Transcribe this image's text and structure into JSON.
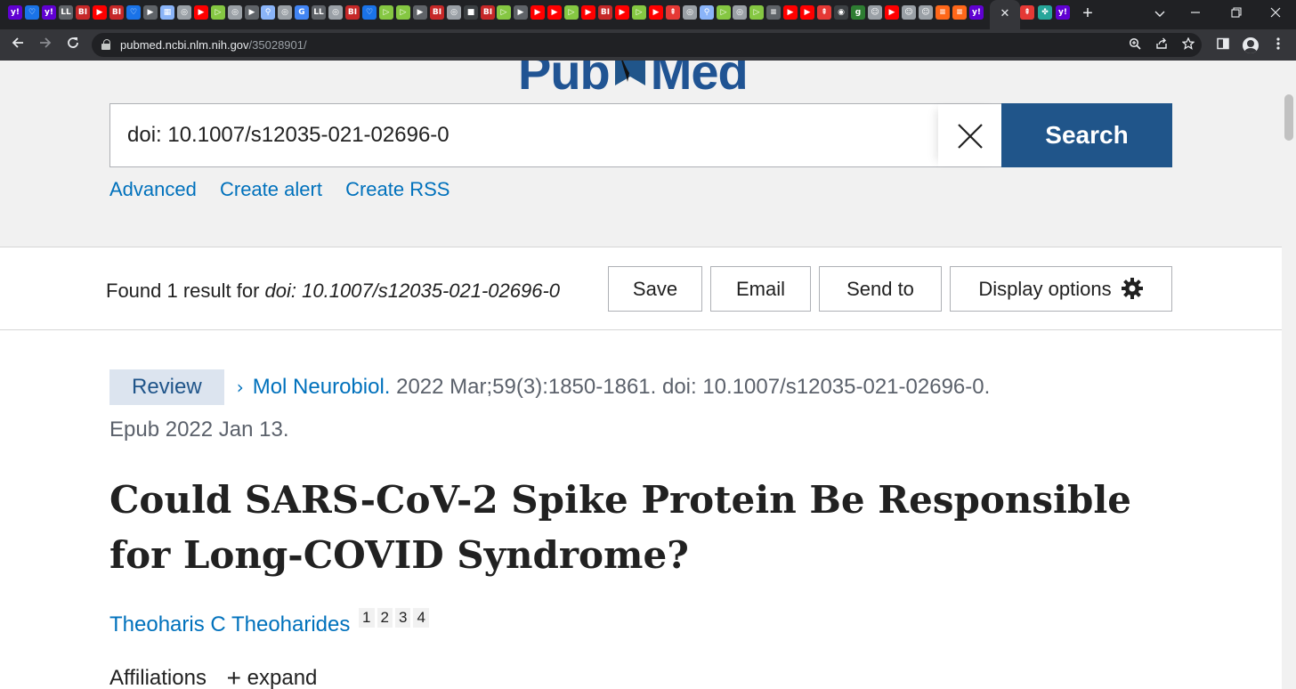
{
  "browser": {
    "tabs": [
      {
        "icon": "yahoo-icon",
        "glyph": "y!",
        "color": "#6001d2"
      },
      {
        "icon": "shield-icon",
        "glyph": "♡",
        "color": "#1a73e8"
      },
      {
        "icon": "yahoo-icon",
        "glyph": "y!",
        "color": "#6001d2"
      },
      {
        "icon": "lifesite-icon",
        "glyph": "LL",
        "color": "#5f6368"
      },
      {
        "icon": "business-insider-icon",
        "glyph": "BI",
        "color": "#c62828"
      },
      {
        "icon": "youtube-icon",
        "glyph": "▶",
        "color": "#ff0000"
      },
      {
        "icon": "business-insider-icon",
        "glyph": "BI",
        "color": "#c62828"
      },
      {
        "icon": "shield-icon",
        "glyph": "♡",
        "color": "#1a73e8"
      },
      {
        "icon": "play-icon",
        "glyph": "▶",
        "color": "#5f6368"
      },
      {
        "icon": "doc-icon",
        "glyph": "▦",
        "color": "#8ab4f8"
      },
      {
        "icon": "globe-icon",
        "glyph": "◎",
        "color": "#9aa0a6"
      },
      {
        "icon": "youtube-icon",
        "glyph": "▶",
        "color": "#ff0000"
      },
      {
        "icon": "rumble-icon",
        "glyph": "▷",
        "color": "#85c742"
      },
      {
        "icon": "globe-icon",
        "glyph": "◎",
        "color": "#9aa0a6"
      },
      {
        "icon": "play-icon",
        "glyph": "▶",
        "color": "#5f6368"
      },
      {
        "icon": "search-icon",
        "glyph": "⚲",
        "color": "#8ab4f8"
      },
      {
        "icon": "globe-icon",
        "glyph": "◎",
        "color": "#9aa0a6"
      },
      {
        "icon": "google-icon",
        "glyph": "G",
        "color": "#4285f4"
      },
      {
        "icon": "lifesite-icon",
        "glyph": "LL",
        "color": "#5f6368"
      },
      {
        "icon": "globe-icon",
        "glyph": "◎",
        "color": "#9aa0a6"
      },
      {
        "icon": "business-insider-icon",
        "glyph": "BI",
        "color": "#c62828"
      },
      {
        "icon": "shield-icon",
        "glyph": "♡",
        "color": "#1a73e8"
      },
      {
        "icon": "rumble-icon",
        "glyph": "▷",
        "color": "#85c742"
      },
      {
        "icon": "rumble-icon",
        "glyph": "▷",
        "color": "#85c742"
      },
      {
        "icon": "play-icon",
        "glyph": "▶",
        "color": "#5f6368"
      },
      {
        "icon": "business-insider-icon",
        "glyph": "BI",
        "color": "#c62828"
      },
      {
        "icon": "globe-icon",
        "glyph": "◎",
        "color": "#9aa0a6"
      },
      {
        "icon": "dark-icon",
        "glyph": "■",
        "color": "#3c4043"
      },
      {
        "icon": "business-insider-icon",
        "glyph": "BI",
        "color": "#c62828"
      },
      {
        "icon": "rumble-icon",
        "glyph": "▷",
        "color": "#85c742"
      },
      {
        "icon": "play-icon",
        "glyph": "▶",
        "color": "#5f6368"
      },
      {
        "icon": "youtube-icon",
        "glyph": "▶",
        "color": "#ff0000"
      },
      {
        "icon": "youtube-icon",
        "glyph": "▶",
        "color": "#ff0000"
      },
      {
        "icon": "rumble-icon",
        "glyph": "▷",
        "color": "#85c742"
      },
      {
        "icon": "youtube-icon",
        "glyph": "▶",
        "color": "#ff0000"
      },
      {
        "icon": "business-insider-icon",
        "glyph": "BI",
        "color": "#c62828"
      },
      {
        "icon": "youtube-icon",
        "glyph": "▶",
        "color": "#ff0000"
      },
      {
        "icon": "rumble-icon",
        "glyph": "▷",
        "color": "#85c742"
      },
      {
        "icon": "youtube-icon",
        "glyph": "▶",
        "color": "#ff0000"
      },
      {
        "icon": "gettr-icon",
        "glyph": "⇞",
        "color": "#e53935"
      },
      {
        "icon": "globe-icon",
        "glyph": "◎",
        "color": "#9aa0a6"
      },
      {
        "icon": "search-icon",
        "glyph": "⚲",
        "color": "#8ab4f8"
      },
      {
        "icon": "rumble-icon",
        "glyph": "▷",
        "color": "#85c742"
      },
      {
        "icon": "globe-icon",
        "glyph": "◎",
        "color": "#9aa0a6"
      },
      {
        "icon": "rumble-icon",
        "glyph": "▷",
        "color": "#85c742"
      },
      {
        "icon": "news-icon",
        "glyph": "≡",
        "color": "#5f6368"
      },
      {
        "icon": "youtube-icon",
        "glyph": "▶",
        "color": "#ff0000"
      },
      {
        "icon": "youtube-icon",
        "glyph": "▶",
        "color": "#ff0000"
      },
      {
        "icon": "gettr-icon",
        "glyph": "⇞",
        "color": "#e53935"
      },
      {
        "icon": "dark-icon",
        "glyph": "◉",
        "color": "#3c4043"
      },
      {
        "icon": "substack-icon",
        "glyph": "g",
        "color": "#2e7d32"
      },
      {
        "icon": "avatar-icon",
        "glyph": "☺",
        "color": "#9aa0a6"
      },
      {
        "icon": "youtube-icon",
        "glyph": "▶",
        "color": "#ff0000"
      },
      {
        "icon": "avatar-icon",
        "glyph": "☺",
        "color": "#9aa0a6"
      },
      {
        "icon": "avatar-icon",
        "glyph": "☺",
        "color": "#9aa0a6"
      },
      {
        "icon": "substack-icon",
        "glyph": "≡",
        "color": "#ff6719"
      },
      {
        "icon": "substack-icon",
        "glyph": "≡",
        "color": "#ff6719"
      },
      {
        "icon": "yahoo-icon",
        "glyph": "y!",
        "color": "#6001d2"
      }
    ],
    "active_tab_close": "✕",
    "after_tabs": [
      {
        "icon": "gettr-icon",
        "glyph": "⇞",
        "color": "#e53935"
      },
      {
        "icon": "leaf-icon",
        "glyph": "✤",
        "color": "#26a69a"
      },
      {
        "icon": "yahoo-icon",
        "glyph": "y!",
        "color": "#6001d2"
      }
    ],
    "new_tab": "+",
    "url_host": "pubmed.ncbi.nlm.nih.gov",
    "url_path": "/35028901/",
    "accent": "#202124"
  },
  "pubmed": {
    "logo_text_left": "Pub",
    "logo_text_right": "Med",
    "search_query": "doi: 10.1007/s12035-021-02696-0",
    "search_button": "Search",
    "links": [
      "Advanced",
      "Create alert",
      "Create RSS"
    ],
    "found_prefix": "Found 1 result for ",
    "found_query": "doi: 10.1007/s12035-021-02696-0",
    "actions": {
      "save": "Save",
      "email": "Email",
      "send_to": "Send to",
      "display_options": "Display options"
    },
    "article": {
      "type_badge": "Review",
      "journal": "Mol Neurobiol.",
      "citation_rest": " 2022 Mar;59(3):1850-1861. doi: 10.1007/s12035-021-02696-0.",
      "epub": "Epub 2022 Jan 13.",
      "title": "Could SARS-CoV-2 Spike Protein Be Responsible for Long-COVID Syndrome?",
      "author": "Theoharis C Theoharides",
      "affiliation_refs": [
        "1",
        "2",
        "3",
        "4"
      ],
      "affiliations_label": "Affiliations",
      "expand_label": "expand"
    },
    "colors": {
      "brand": "#20558a",
      "link": "#0071bc",
      "band_bg": "#f1f1f1",
      "badge_bg": "#dce4ef"
    }
  }
}
